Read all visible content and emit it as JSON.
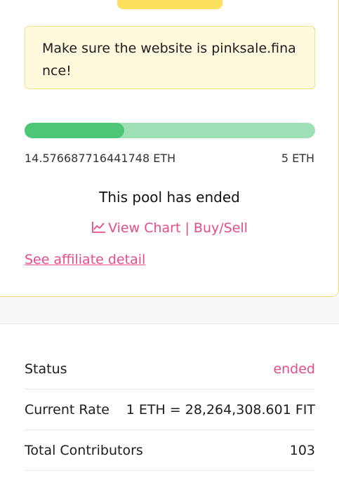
{
  "notice": {
    "text": "Make sure the website is pinksale.finance!"
  },
  "progress": {
    "fraction": 0.343,
    "raised": "14.576687716441748 ETH",
    "cap": "5 ETH"
  },
  "pool": {
    "status_message": "This pool has ended",
    "view_chart_label": "View Chart",
    "separator": "|",
    "buy_sell_label": "Buy/Sell",
    "affiliate_link": "See affiliate detail"
  },
  "info": {
    "rows": [
      {
        "label": "Status",
        "value": "ended"
      },
      {
        "label": "Current Rate",
        "value": "1 ETH = 28,264,308.601 FIT"
      },
      {
        "label": "Total Contributors",
        "value": "103"
      }
    ]
  },
  "colors": {
    "accent_pink": "#e64c8a",
    "progress_fill": "#4cc776",
    "progress_track": "#a0e0b6",
    "notice_bg": "#fff9dd",
    "tab_yellow": "#fde05e"
  },
  "icons": {
    "chart": "line-chart-icon"
  }
}
